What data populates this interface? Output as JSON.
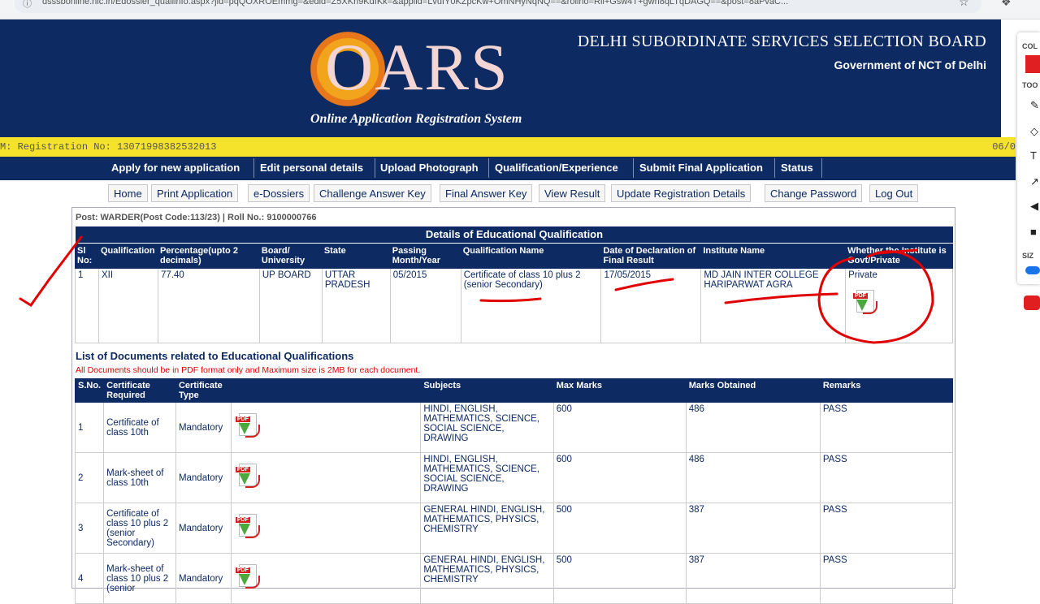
{
  "browser": {
    "url": "dsssbonline.nic.in/Edossier_qualiinfo.aspx?jid=pqQOXROEmmg=&edid=Z5XKh9KdIKk=&applid=LvuIY0KZpcKw+OmNHyNqNQ==&rollno=Rll+Gsw4T+gwn8qLTqDAGQ==&post=8aPvaC..."
  },
  "header": {
    "logo_text": "OARS",
    "logo_subtitle": "Online Application Registration System",
    "org_title": "DELHI SUBORDINATE SERVICES SELECTION BOARD",
    "org_subtitle": "Government of NCT of Delhi"
  },
  "regbar": {
    "left": "M: Registration No: 13071998382532013",
    "right": "06/0"
  },
  "nav1": [
    "Apply for new application",
    "Edit personal details",
    "Upload Photograph",
    "Qualification/Experience",
    "Submit Final Application",
    "Status"
  ],
  "nav2": [
    "Home",
    "Print Application",
    "e-Dossiers",
    "Challenge Answer Key",
    "Final Answer Key",
    "View Result",
    "Update Registration Details",
    "Change Password",
    "Log Out"
  ],
  "post_line": "Post: WARDER(Post Code:113/23) | Roll No.: 9100000766",
  "edu": {
    "title": "Details of Educational Qualification",
    "columns": [
      "Sl No:",
      "Qualification",
      "Percentage(upto 2 decimals)",
      "Board/ University",
      "State",
      "Passing Month/Year",
      "Qualification Name",
      "Date of Declaration of Final Result",
      "Institute Name",
      "Whether the Institute is Govt/Private"
    ],
    "row": {
      "sl": "1",
      "qualification": "XII",
      "percentage": "77.40",
      "board": "UP BOARD",
      "state": "UTTAR PRADESH",
      "passing": "05/2015",
      "qual_name": "Certificate of class 10 plus 2 (senior Secondary)",
      "declaration": "17/05/2015",
      "institute": "MD JAIN INTER COLLEGE HARIPARWAT AGRA",
      "govt_private": "Private"
    }
  },
  "docs": {
    "title": "List of Documents related to Educational Qualifications",
    "note": "All Documents should be in PDF format only and Maximum size is 2MB for each document.",
    "columns": [
      "S.No.",
      "Certificate Required",
      "Certificate Type",
      "",
      "Subjects",
      "Max Marks",
      "Marks Obtained",
      "Remarks"
    ],
    "rows": [
      {
        "sno": "1",
        "cert": "Certificate of class 10th",
        "type": "Mandatory",
        "subjects": "HINDI, ENGLISH, MATHEMATICS, SCIENCE, SOCIAL SCIENCE, DRAWING",
        "max": "600",
        "obtained": "486",
        "remarks": "PASS"
      },
      {
        "sno": "2",
        "cert": "Mark-sheet of class 10th",
        "type": "Mandatory",
        "subjects": "HINDI, ENGLISH, MATHEMATICS, SCIENCE, SOCIAL SCIENCE, DRAWING",
        "max": "600",
        "obtained": "486",
        "remarks": "PASS"
      },
      {
        "sno": "3",
        "cert": "Certificate of class 10 plus 2 (senior Secondary)",
        "type": "Mandatory",
        "subjects": "GENERAL HINDI, ENGLISH, MATHEMATICS, PHYSICS, CHEMISTRY",
        "max": "500",
        "obtained": "387",
        "remarks": "PASS"
      },
      {
        "sno": "4",
        "cert": "Mark-sheet of class 10 plus 2 (senior",
        "type": "Mandatory",
        "subjects": "GENERAL HINDI, ENGLISH, MATHEMATICS, PHYSICS, CHEMISTRY",
        "max": "500",
        "obtained": "387",
        "remarks": "PASS"
      }
    ]
  },
  "pdf_label": "PDF",
  "sidebar": {
    "labels": [
      "COL",
      "TOO",
      "SIZ"
    ]
  },
  "colors": {
    "navy": "#0d2a63",
    "yellow": "#f5e22a",
    "annotation_red": "#e00000"
  }
}
